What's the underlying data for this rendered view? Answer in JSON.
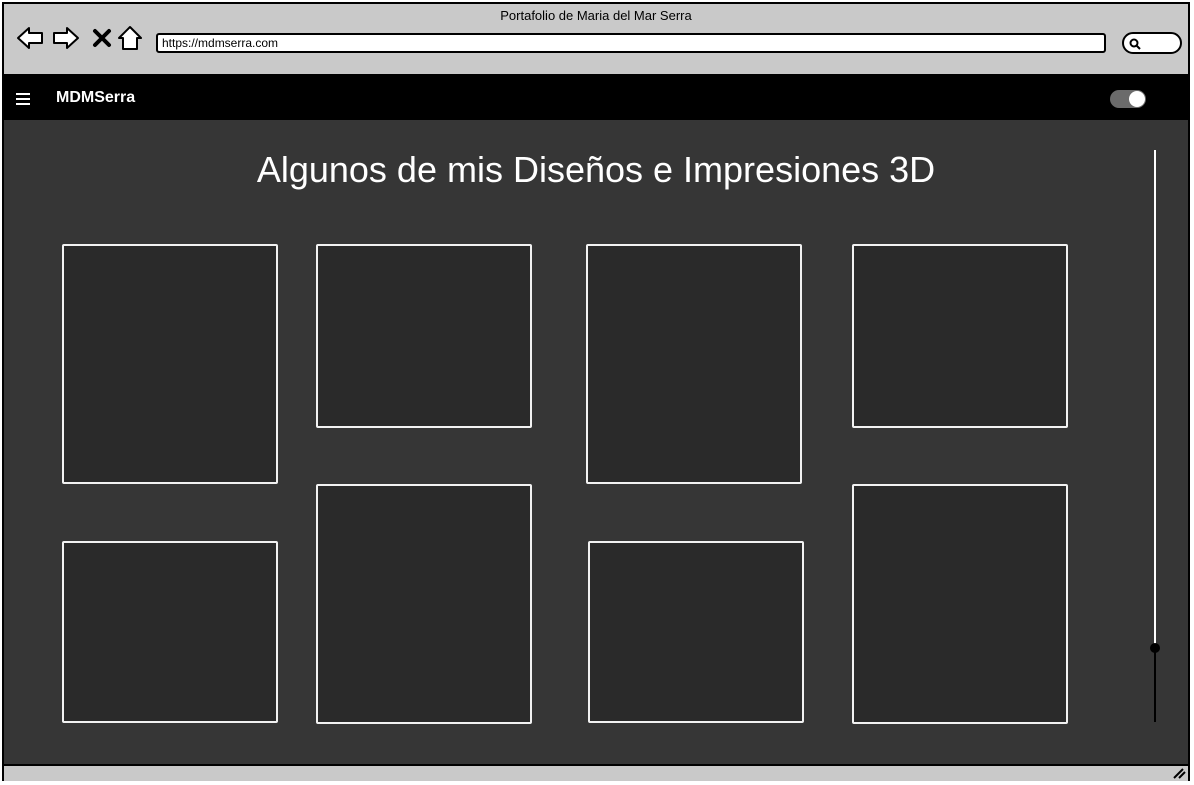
{
  "window": {
    "title": "Portafolio de Maria del Mar Serra"
  },
  "browser": {
    "url": "https://mdmserra.com",
    "icons": [
      "back-arrow-icon",
      "forward-arrow-icon",
      "close-icon",
      "home-icon",
      "search-icon"
    ]
  },
  "appbar": {
    "brand": "MDMSerra",
    "menu_icon": "hamburger-menu-icon",
    "toggle_on": true
  },
  "main": {
    "title": "Algunos de mis Diseños e Impresiones 3D",
    "gallery_items": [
      {
        "name": "gallery-item-1"
      },
      {
        "name": "gallery-item-2"
      },
      {
        "name": "gallery-item-3"
      },
      {
        "name": "gallery-item-4"
      },
      {
        "name": "gallery-item-5"
      },
      {
        "name": "gallery-item-6"
      },
      {
        "name": "gallery-item-7"
      },
      {
        "name": "gallery-item-8"
      }
    ]
  },
  "scroll_slider": {
    "value": 0.87
  },
  "colors": {
    "window_chrome": "#c9c9c9",
    "appbar": "#000000",
    "content_bg": "#363636",
    "card_bg": "#2a2a2a",
    "card_border": "#f2f2f2"
  }
}
